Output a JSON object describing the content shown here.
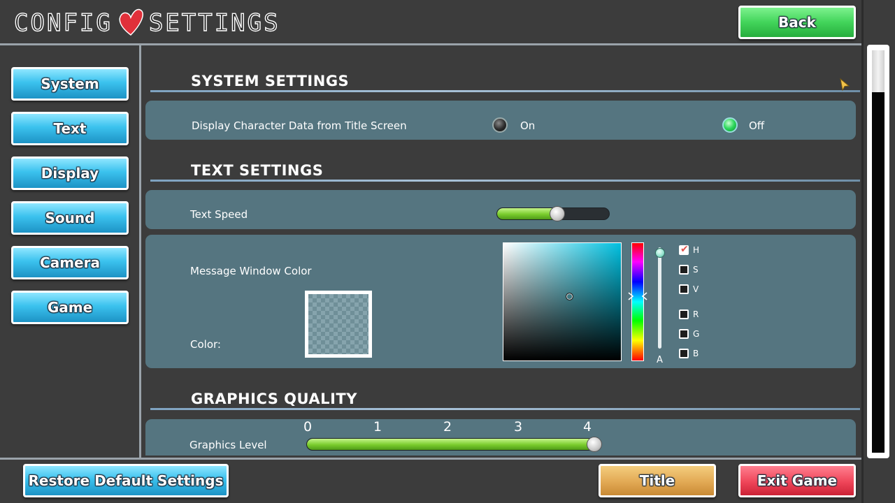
{
  "header": {
    "title_left": "CONFIG",
    "title_right": "SETTINGS",
    "back_label": "Back"
  },
  "sidebar": {
    "items": [
      {
        "label": "System"
      },
      {
        "label": "Text"
      },
      {
        "label": "Display"
      },
      {
        "label": "Sound"
      },
      {
        "label": "Camera"
      },
      {
        "label": "Game"
      }
    ]
  },
  "system_settings": {
    "title": "SYSTEM SETTINGS",
    "display_char_label": "Display Character Data from Title Screen",
    "on_label": "On",
    "off_label": "Off",
    "selected": "Off"
  },
  "text_settings": {
    "title": "TEXT SETTINGS",
    "text_speed_label": "Text Speed",
    "text_speed_value": 0.54,
    "message_window_label": "Message Window Color",
    "color_label": "Color:",
    "channels": [
      {
        "label": "H",
        "checked": true
      },
      {
        "label": "S",
        "checked": false
      },
      {
        "label": "V",
        "checked": false
      },
      {
        "label": "R",
        "checked": false
      },
      {
        "label": "G",
        "checked": false
      },
      {
        "label": "B",
        "checked": false
      }
    ],
    "alpha_label": "A"
  },
  "graphics_quality": {
    "title": "GRAPHICS QUALITY",
    "level_label": "Graphics Level",
    "ticks": [
      "0",
      "1",
      "2",
      "3",
      "4"
    ],
    "level_value": 4
  },
  "footer": {
    "restore_label": "Restore Default Settings",
    "title_label": "Title",
    "exit_label": "Exit Game"
  },
  "colors": {
    "panel": "#557580",
    "accent_blue": "#3bc2ee",
    "accent_green": "#42d45a",
    "accent_gold": "#e2a954",
    "accent_red": "#ef4559",
    "heart": "#e0303a"
  }
}
